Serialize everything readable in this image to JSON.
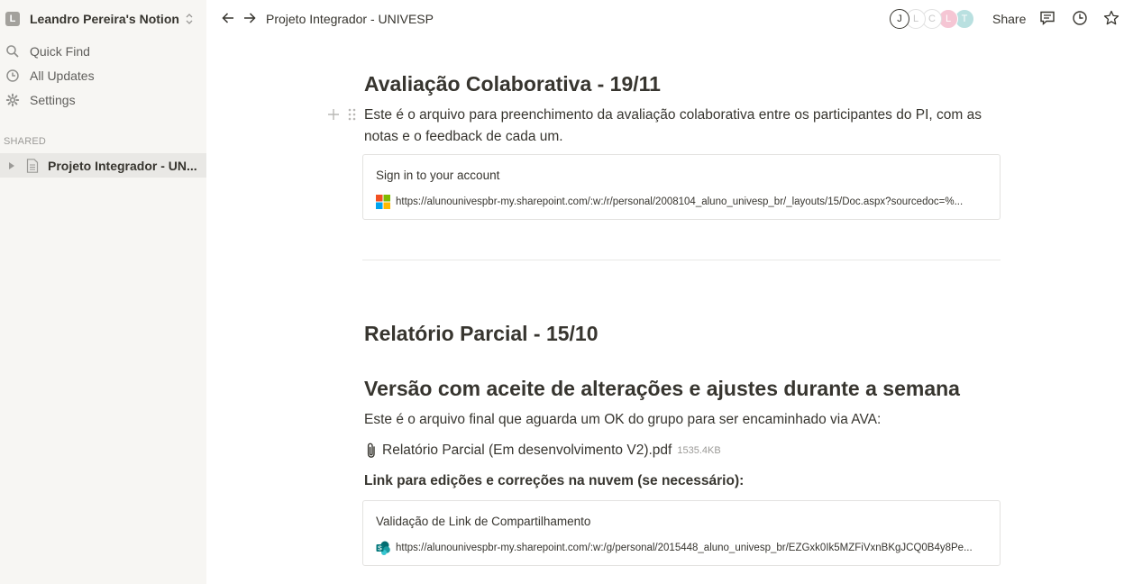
{
  "sidebar": {
    "workspace_initial": "L",
    "workspace_name": "Leandro Pereira's Notion",
    "quick_find": "Quick Find",
    "all_updates": "All Updates",
    "settings": "Settings",
    "shared_label": "SHARED",
    "page_label": "Projeto Integrador - UN..."
  },
  "topbar": {
    "breadcrumb": "Projeto Integrador - UNIVESP",
    "share_label": "Share",
    "avatars": [
      {
        "initial": "J",
        "color": "#ffffff"
      },
      {
        "initial": "L",
        "color": "#ffffff"
      },
      {
        "initial": "C",
        "color": "#ffffff"
      },
      {
        "initial": "L",
        "color": "#f5c6d4"
      },
      {
        "initial": "T",
        "color": "#b9e0e0"
      }
    ]
  },
  "content": {
    "heading1": "Avaliação Colaborativa - 19/11",
    "para1": "Este é o arquivo para preenchimento da avaliação colaborativa entre os participantes do PI, com as notas e o feedback de cada um.",
    "bookmark1": {
      "title": "Sign in to your account",
      "url": "https://alunounivespbr-my.sharepoint.com/:w:/r/personal/2008104_aluno_univesp_br/_layouts/15/Doc.aspx?sourcedoc=%..."
    },
    "heading2": "Relatório Parcial - 15/10",
    "heading3": "Versão com aceite de alterações e ajustes durante a semana",
    "para2": "Este é o arquivo final que aguarda um OK do grupo para ser encaminhado via AVA:",
    "file": {
      "name": "Relatório Parcial (Em desenvolvimento V2).pdf",
      "size": "1535.4KB"
    },
    "bold_line": "Link para edições e correções na nuvem (se necessário):",
    "bookmark2": {
      "title": "Validação de Link de Compartilhamento",
      "url": "https://alunounivespbr-my.sharepoint.com/:w:/g/personal/2015448_aluno_univesp_br/EZGxk0Ik5MZFiVxnBKgJCQ0B4y8Pe..."
    }
  }
}
